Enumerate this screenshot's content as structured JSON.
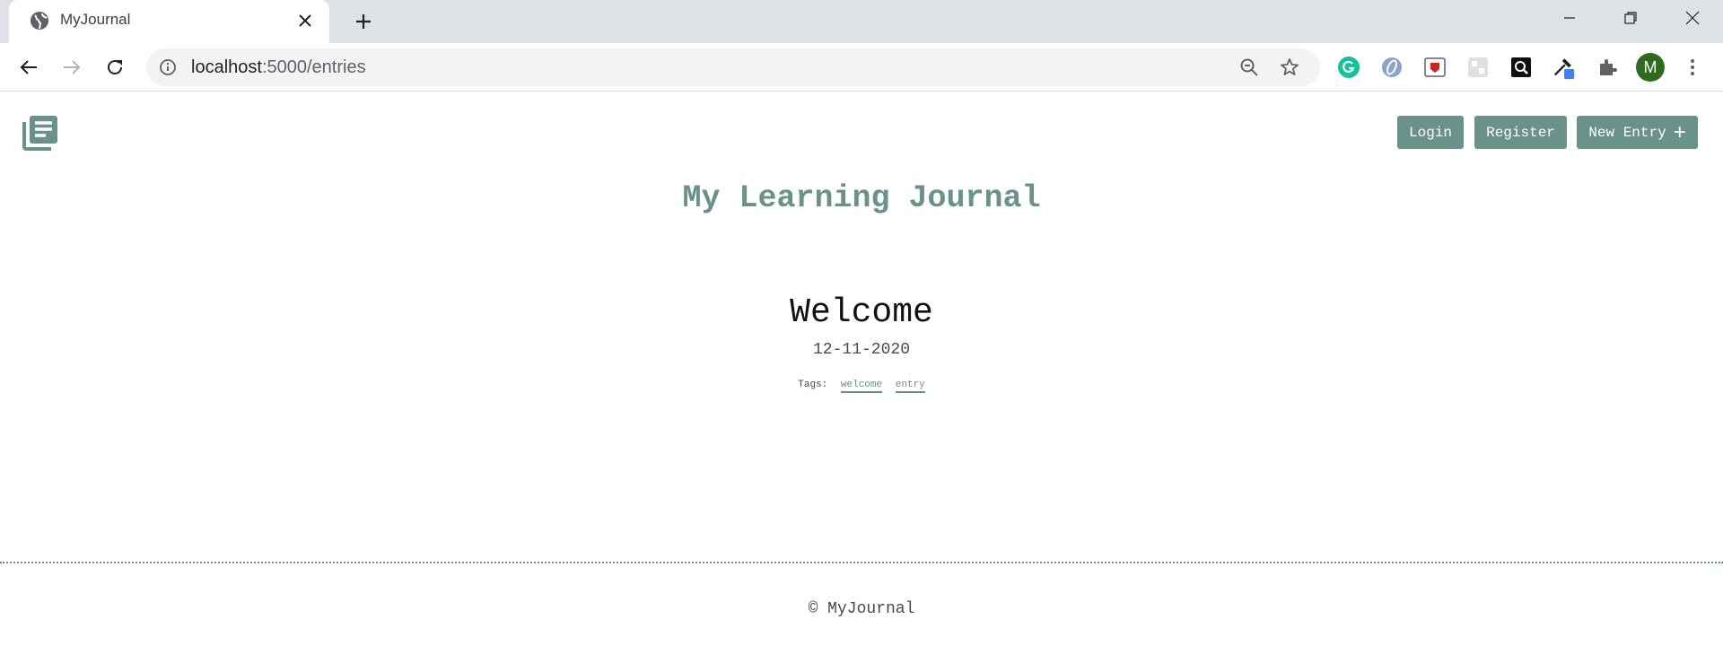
{
  "browser": {
    "tab_title": "MyJournal",
    "url_host": "localhost",
    "url_path": ":5000/entries",
    "profile_initial": "M"
  },
  "header": {
    "login_label": "Login",
    "register_label": "Register",
    "new_entry_label": "New Entry",
    "new_entry_icon": "+"
  },
  "site_title": "My Learning Journal",
  "entry": {
    "title": "Welcome",
    "date": "12-11-2020",
    "tags_label": "Tags:",
    "tags": [
      "welcome",
      "entry"
    ]
  },
  "footer": {
    "text": "© MyJournal"
  },
  "colors": {
    "accent": "#6b918b",
    "profile": "#2e6b1e"
  }
}
